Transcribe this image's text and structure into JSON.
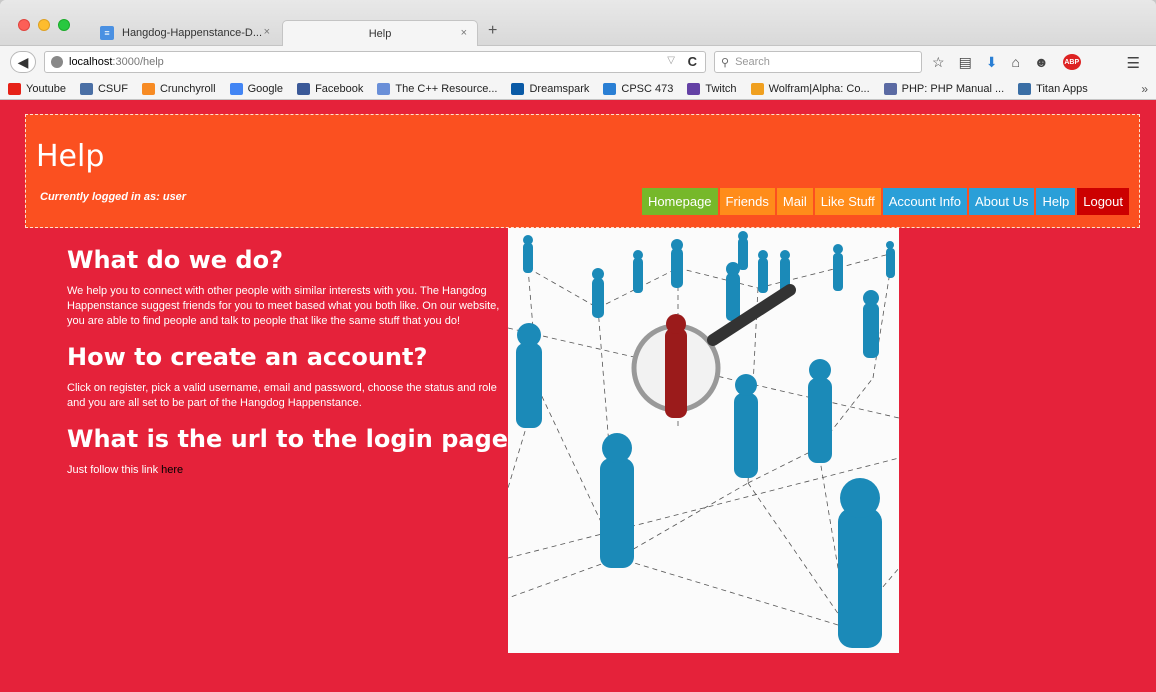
{
  "browser": {
    "tabs": [
      {
        "label": "Hangdog-Happenstance-D...",
        "close": "×"
      },
      {
        "label": "Help",
        "close": "×"
      }
    ],
    "new_tab": "+",
    "url_host": "localhost",
    "url_path": ":3000/help",
    "search_placeholder": "Search",
    "bookmarks": [
      {
        "label": "Youtube",
        "color": "#e62117"
      },
      {
        "label": "CSUF",
        "color": "#4a6fa5"
      },
      {
        "label": "Crunchyroll",
        "color": "#f78b24"
      },
      {
        "label": "Google",
        "color": "#4285f4"
      },
      {
        "label": "Facebook",
        "color": "#3b5998"
      },
      {
        "label": "The C++ Resource...",
        "color": "#6a8fd8"
      },
      {
        "label": "Dreamspark",
        "color": "#0a5aa6"
      },
      {
        "label": "CPSC 473",
        "color": "#2a7fd4"
      },
      {
        "label": "Twitch",
        "color": "#6441a5"
      },
      {
        "label": "Wolfram|Alpha: Co...",
        "color": "#f0a020"
      },
      {
        "label": "PHP: PHP Manual ...",
        "color": "#5b6aa3"
      },
      {
        "label": "Titan Apps",
        "color": "#3a6ea5"
      }
    ],
    "bookmarks_more": "»"
  },
  "page": {
    "title": "Help",
    "login_status": "Currently logged in as: user",
    "nav": [
      {
        "label": "Homepage",
        "color": "#76b82a"
      },
      {
        "label": "Friends",
        "color": "#ff8c1a"
      },
      {
        "label": "Mail",
        "color": "#ff8c1a"
      },
      {
        "label": "Like Stuff",
        "color": "#ff8c1a"
      },
      {
        "label": "Account Info",
        "color": "#2a9fd8"
      },
      {
        "label": "About Us",
        "color": "#2a9fd8"
      },
      {
        "label": "Help",
        "color": "#2a9fd8"
      },
      {
        "label": "Logout",
        "color": "#cc0000"
      }
    ],
    "sections": [
      {
        "heading": "What do we do?",
        "body": "We help you to connect with other people with similar interests with you. The Hangdog Happenstance suggest friends for you to meet based what you both like. On our website, you are able to find people and talk to people that like the same stuff that you do!"
      },
      {
        "heading": "How to create an account?",
        "body": "Click on register, pick a valid username, email and password, choose the status and role and you are all set to be part of the Hangdog Happenstance."
      },
      {
        "heading": "What is the url to the login page?",
        "body": "Just follow this link ",
        "link": "here"
      }
    ]
  },
  "colors": {
    "page_bg": "#e5223a",
    "header_bg": "#fb5020"
  }
}
